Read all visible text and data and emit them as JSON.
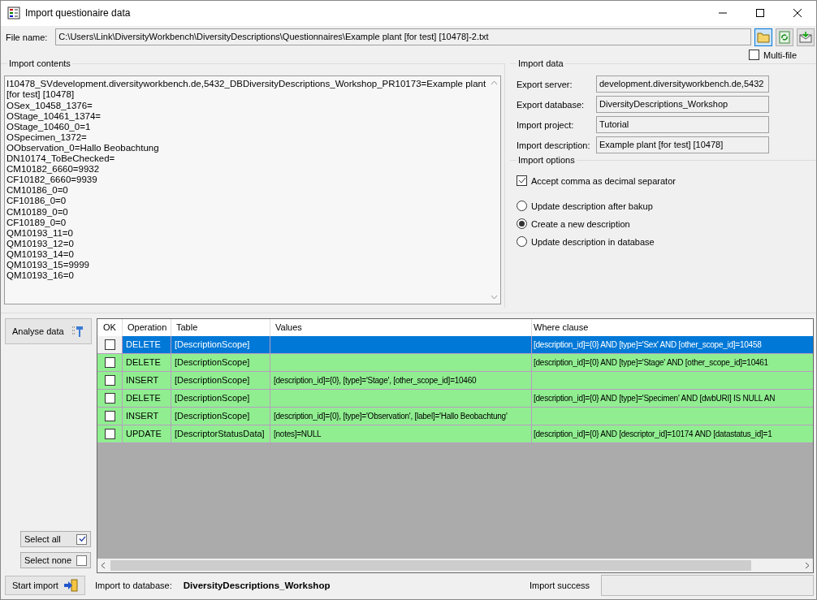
{
  "window": {
    "title": "Import questionaire data"
  },
  "file": {
    "label": "File name:",
    "value": "C:\\Users\\Link\\DiversityWorkbench\\DiversityDescriptions\\Questionnaires\\Example plant [for test] [10478]-2.txt"
  },
  "multi_file": {
    "label": "Multi-file",
    "checked": false
  },
  "import_contents": {
    "title": "Import contents",
    "lines": [
      "I10478_SVdevelopment.diversityworkbench.de,5432_DBDiversityDescriptions_Workshop_PR10173=Example plant [for test] [10478]",
      "OSex_10458_1376=",
      "OStage_10461_1374=",
      "OStage_10460_0=1",
      "OSpecimen_1372=",
      "OObservation_0=Hallo Beobachtung",
      "DN10174_ToBeChecked=",
      "CM10182_6660=9932",
      "CF10182_6660=9939",
      "CM10186_0=0",
      "CF10186_0=0",
      "CM10189_0=0",
      "CF10189_0=0",
      "QM10193_11=0",
      "QM10193_12=0",
      "QM10193_14=0",
      "QM10193_15=9999",
      "QM10193_16=0"
    ]
  },
  "import_data": {
    "title": "Import data",
    "fields": [
      {
        "label": "Export server:",
        "value": "development.diversityworkbench.de,5432"
      },
      {
        "label": "Export database:",
        "value": "DiversityDescriptions_Workshop"
      },
      {
        "label": "Import project:",
        "value": "Tutorial"
      },
      {
        "label": "Import description:",
        "value": "Example plant [for test] [10478]"
      }
    ]
  },
  "import_options": {
    "title": "Import options",
    "checkbox": {
      "label": "Accept comma as decimal separator",
      "checked": true
    },
    "radios": [
      {
        "label": "Update description after bakup",
        "selected": false
      },
      {
        "label": "Create a new description",
        "selected": true
      },
      {
        "label": "Update description in database",
        "selected": false
      }
    ]
  },
  "analyse_button": "Analyse data",
  "table": {
    "columns": [
      "OK",
      "Operation",
      "Table",
      "Values",
      "Where clause"
    ],
    "rows": [
      {
        "checked": false,
        "selected": true,
        "operation": "DELETE",
        "table": "[DescriptionScope]",
        "values": "",
        "where": "[description_id]={0} AND [type]='Sex' AND [other_scope_id]=10458"
      },
      {
        "checked": false,
        "selected": false,
        "operation": "DELETE",
        "table": "[DescriptionScope]",
        "values": "",
        "where": "[description_id]={0} AND [type]='Stage' AND [other_scope_id]=10461"
      },
      {
        "checked": false,
        "selected": false,
        "operation": "INSERT",
        "table": "[DescriptionScope]",
        "values": "[description_id]={0}, [type]='Stage', [other_scope_id]=10460",
        "where": ""
      },
      {
        "checked": false,
        "selected": false,
        "operation": "DELETE",
        "table": "[DescriptionScope]",
        "values": "",
        "where": "[description_id]={0} AND [type]='Specimen' AND [dwbURI] IS NULL AN"
      },
      {
        "checked": false,
        "selected": false,
        "operation": "INSERT",
        "table": "[DescriptionScope]",
        "values": "[description_id]={0}, [type]='Observation', [label]='Hallo Beobachtung'",
        "where": ""
      },
      {
        "checked": false,
        "selected": false,
        "operation": "UPDATE",
        "table": "[DescriptorStatusData]",
        "values": "[notes]=NULL",
        "where": "[description_id]={0} AND [descriptor_id]=10174 AND [datastatus_id]=1"
      }
    ]
  },
  "select_all": {
    "label": "Select all",
    "checked": true
  },
  "select_none": {
    "label": "Select none",
    "checked": false
  },
  "start_button": "Start import",
  "footer": {
    "db_label": "Import to database:",
    "db_value": "DiversityDescriptions_Workshop",
    "success_label": "Import success"
  }
}
